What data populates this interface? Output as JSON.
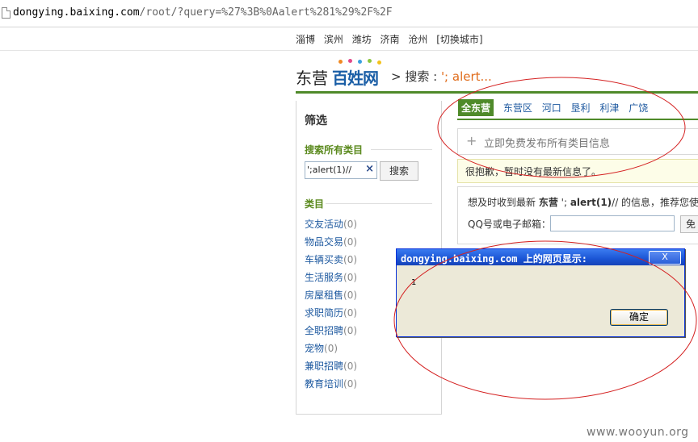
{
  "address_bar": {
    "url_host": "dongying.baixing.com",
    "url_path": "/root/?query=%27%3B%0Aalert%281%29%2F%2F"
  },
  "city_bar": {
    "cities": [
      "淄博",
      "滨州",
      "潍坊",
      "济南",
      "沧州"
    ],
    "switch_label": "[切换城市]"
  },
  "header": {
    "city": "东营",
    "logo_text": "百姓网",
    "breadcrumb_prefix": "> 搜索 : ",
    "breadcrumb_query": "'; alert..."
  },
  "filter": {
    "title": "筛选",
    "search_section": "搜索所有类目",
    "search_value": "';alert(1)//",
    "clear_symbol": "×",
    "search_button": "搜索",
    "category_section": "类目",
    "categories": [
      {
        "label": "交友活动",
        "count": "(0)"
      },
      {
        "label": "物品交易",
        "count": "(0)"
      },
      {
        "label": "车辆买卖",
        "count": "(0)"
      },
      {
        "label": "生活服务",
        "count": "(0)"
      },
      {
        "label": "房屋租售",
        "count": "(0)"
      },
      {
        "label": "求职简历",
        "count": "(0)"
      },
      {
        "label": "全职招聘",
        "count": "(0)"
      },
      {
        "label": "宠物",
        "count": "(0)"
      },
      {
        "label": "兼职招聘",
        "count": "(0)"
      },
      {
        "label": "教育培训",
        "count": "(0)"
      }
    ]
  },
  "tabs": [
    "全东营",
    "东营区",
    "河口",
    "垦利",
    "利津",
    "广饶"
  ],
  "post_box": {
    "plus": "+",
    "text": "立即免费发布所有类目信息"
  },
  "notice": "很抱歉，暂时没有最新信息了。",
  "subscribe": {
    "text_prefix": "想及时收到最新 ",
    "text_city": "东营",
    "text_mid": " '; ",
    "text_query": "alert(1)",
    "text_suffix": "// 的信息，推荐您使用",
    "label": "QQ号或电子邮箱：",
    "button": "免"
  },
  "dialog": {
    "title": "dongying.baixing.com 上的网页显示:",
    "close": "X",
    "message": "1",
    "ok": "确定"
  },
  "watermark": "www.wooyun.org",
  "colors": {
    "accent_green": "#4f8a2a",
    "link_blue": "#1f5aa0",
    "annotation_red": "#d42020",
    "dialog_blue": "#1a54d4"
  }
}
